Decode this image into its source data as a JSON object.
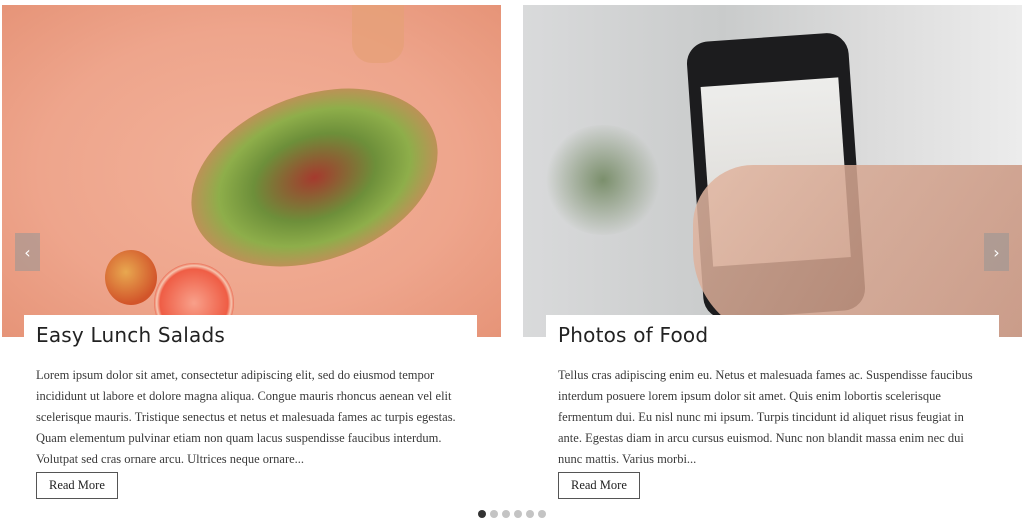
{
  "slides": [
    {
      "title": "Easy Lunch Salads",
      "excerpt": "Lorem ipsum dolor sit amet, consectetur adipiscing elit, sed do eiusmod tempor incididunt ut labore et dolore magna aliqua. Congue mauris rhoncus aenean vel elit scelerisque mauris. Tristique senectus et netus et malesuada fames ac turpis egestas. Quam elementum pulvinar etiam non quam lacus suspendisse faucibus interdum. Volutpat sed cras ornare arcu. Ultrices neque ornare...",
      "button": "Read More"
    },
    {
      "title": "Photos of Food",
      "excerpt": "Tellus cras adipiscing enim eu. Netus et malesuada fames ac. Suspendisse faucibus interdum posuere lorem ipsum dolor sit amet. Quis enim lobortis scelerisque fermentum dui. Eu nisl nunc mi ipsum. Turpis tincidunt id aliquet risus feugiat in ante. Egestas diam in arcu cursus euismod. Nunc non blandit massa enim nec dui nunc mattis. Varius morbi...",
      "button": "Read More"
    }
  ],
  "nav": {
    "prev_icon": "‹",
    "next_icon": "›"
  },
  "pagination": {
    "total": 6,
    "active": 1
  }
}
